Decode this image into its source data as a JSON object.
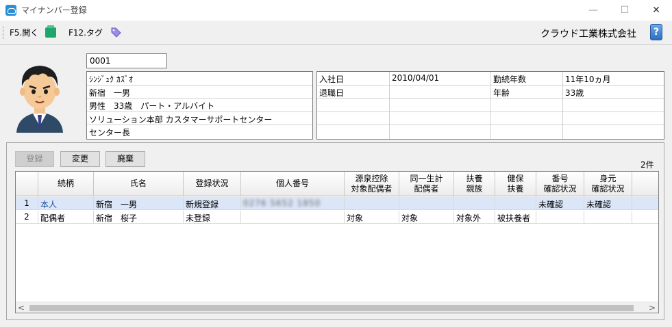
{
  "window": {
    "title": "マイナンバー登録",
    "minimize": "—",
    "maximize": "☐",
    "close": "✕"
  },
  "toolbar": {
    "open_label": "F5.開く",
    "tag_label": "F12.タグ",
    "company": "クラウド工業株式会社",
    "help_label": "?"
  },
  "employee": {
    "code": "0001",
    "kana": "ｼﾝｼﾞｭｸ ｶｽﾞｵ",
    "name": "新宿　一男",
    "attributes": "男性　33歳　パート・アルバイト",
    "department": "ソリューション本部 カスタマーサポートセンター",
    "position": "センター長"
  },
  "info": {
    "hire_date_label": "入社日",
    "hire_date": "2010/04/01",
    "tenure_label": "勤続年数",
    "tenure": "11年10ヵ月",
    "retire_label": "退職日",
    "retire_date": "",
    "age_label": "年齢",
    "age": "33歳"
  },
  "actions": {
    "register": "登録",
    "change": "変更",
    "discard": "廃棄",
    "count": "2件"
  },
  "grid": {
    "headers": [
      "",
      "続柄",
      "氏名",
      "登録状況",
      "個人番号",
      "源泉控除\n対象配偶者",
      "同一生計\n配偶者",
      "扶養\n親族",
      "健保\n扶養",
      "番号\n確認状況",
      "身元\n確認状況",
      ""
    ],
    "rows": [
      [
        "1",
        "本人",
        "新宿　一男",
        "新規登録",
        "0276 5652 1850",
        "",
        "",
        "",
        "",
        "未確認",
        "未確認",
        ""
      ],
      [
        "2",
        "配偶者",
        "新宿　桜子",
        "未登録",
        "",
        "対象",
        "対象",
        "対象外",
        "被扶養者",
        "",
        "",
        ""
      ]
    ]
  },
  "scroll": {
    "left": "<",
    "right": ">"
  }
}
